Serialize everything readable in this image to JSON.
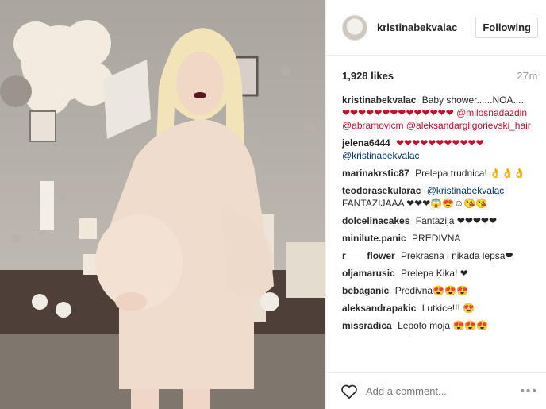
{
  "post": {
    "username": "kristinabekvalac",
    "follow_label": "Following",
    "likes": "1,928 likes",
    "time": "27m"
  },
  "comments": [
    {
      "user": "kristinabekvalac",
      "text": "Baby shower......NOA.....",
      "extra": "❤❤❤❤❤❤❤❤❤❤❤❤❤❤ @milosnadazdin @abramovicm @aleksandargligorievski_hair"
    },
    {
      "user": "jelena6444",
      "text": "❤❤❤❤❤❤❤❤❤❤❤",
      "extra": "@kristinabekvalac"
    },
    {
      "user": "marinakrstic87",
      "text": "Prelepa trudnica! 👌👌👌",
      "extra": ""
    },
    {
      "user": "teodorasekularac",
      "text": "@kristinabekvalac",
      "extra": "FANTAZIJAAA ❤❤❤😱😍☺😘😘"
    },
    {
      "user": "dolcelinacakes",
      "text": "Fantazija ❤❤❤❤❤",
      "extra": ""
    },
    {
      "user": "minilute.panic",
      "text": "PREDIVNA",
      "extra": ""
    },
    {
      "user": "r____flower",
      "text": "Prekrasna i nikada lepsa❤",
      "extra": ""
    },
    {
      "user": "oljamarusic",
      "text": "Prelepa Kika! ❤",
      "extra": ""
    },
    {
      "user": "bebaganic",
      "text": "Predivna😍😍😍",
      "extra": ""
    },
    {
      "user": "aleksandrapakic",
      "text": "Lutkice!!! 😍",
      "extra": ""
    },
    {
      "user": "missradica",
      "text": "Lepoto moja 😍😍😍",
      "extra": ""
    }
  ],
  "footer": {
    "placeholder": "Add a comment...",
    "more": "•••"
  }
}
